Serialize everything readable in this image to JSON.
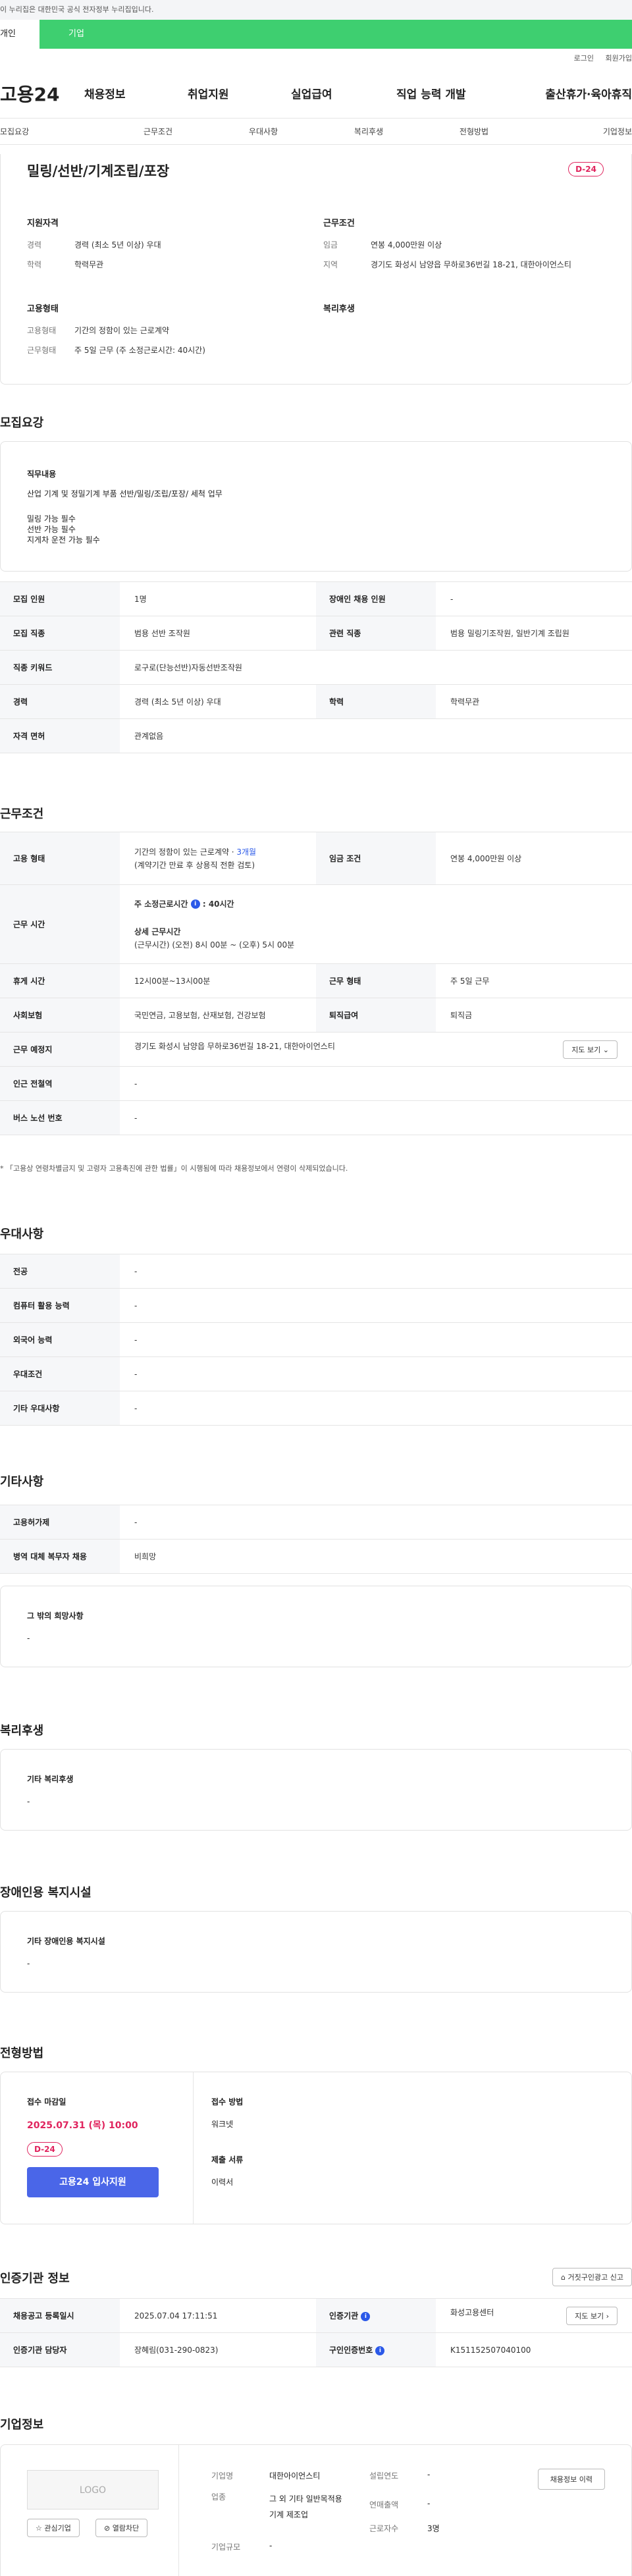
{
  "gov_banner": "이 누리집은 대한민국 공식 전자정부 누리집입니다.",
  "user_tabs": [
    "개인",
    "기업"
  ],
  "util_links": [
    "로그인",
    "회원가입"
  ],
  "site_logo": "고용24",
  "gnb": [
    "채용정보",
    "취업지원",
    "실업급여",
    "직업 능력 개발",
    "출산휴가·육아휴직"
  ],
  "lnb": [
    "모집요강",
    "근무조건",
    "우대사항",
    "복리후생",
    "전형방법",
    "기업정보"
  ],
  "job": {
    "title": "밀링/선반/기계조립/포장",
    "dday": "D-24",
    "qual_title": "지원자격",
    "career_k": "경력",
    "career_v": "경력 (최소 5년 이상) 우대",
    "edu_k": "학력",
    "edu_v": "학력무관",
    "emp_title": "고용형태",
    "emptype_k": "고용형태",
    "emptype_v": "기간의 정함이 있는 근로계약",
    "worktype_k": "근무형태",
    "worktype_v": "주 5일 근무 (주 소정근로시간: 40시간)",
    "cond_title": "근무조건",
    "wage_k": "임금",
    "wage_v": "연봉 4,000만원 이상",
    "region_k": "지역",
    "region_v": "경기도 화성시 남양읍 무하로36번길 18-21, 대한아이언스티",
    "welfare_title": "복리후생"
  },
  "recruit": {
    "title": "모집요강",
    "duty_label": "직무내용",
    "duty_line1": "산업 기계 및 정밀기계 부품 선반/밀링/조립/포장/ 세척 업무",
    "duty_line2": "밀링 가능 필수",
    "duty_line3": "선반 가능 필수",
    "duty_line4": "지게차 운전 가능 필수",
    "rows": {
      "r1h1": "모집 인원",
      "r1v1": "1명",
      "r1h2": "장애인 채용 인원",
      "r1v2": "-",
      "r2h1": "모집 직종",
      "r2v1": "범용 선반 조작원",
      "r2h2": "관련 직종",
      "r2v2": "범용 밀링기조작원, 일반기계 조립원",
      "r3h1": "직종 키워드",
      "r3v1": "로구로(단능선반)자동선반조작원",
      "r4h1": "경력",
      "r4v1": "경력 (최소 5년 이상) 우대",
      "r4h2": "학력",
      "r4v2": "학력무관",
      "r5h1": "자격 면허",
      "r5v1": "관계없음"
    }
  },
  "work": {
    "title": "근무조건",
    "emp_h": "고용 형태",
    "emp_v1": "기간의 정함이 있는 근로계약 · ",
    "emp_period": "3개월",
    "emp_v2": "(계약기간 만료 후 상용직 전환 검토)",
    "wage_h": "임금 조건",
    "wage_v": "연봉 4,000만원 이상",
    "hours_h": "근무 시간",
    "hours_l1": "주 소정근로시간",
    "hours_v1": "40시간",
    "hours_l2": "상세 근무시간",
    "hours_v2": "(근무시간) (오전) 8시 00분 ~ (오후) 5시 00분",
    "break_h": "휴게 시간",
    "break_v": "12시00분~13시00분",
    "form_h": "근무 형태",
    "form_v": "주 5일 근무",
    "ins_h": "사회보험",
    "ins_v": "국민연금, 고용보험, 산재보험, 건강보험",
    "sev_h": "퇴직급여",
    "sev_v": "퇴직금",
    "place_h": "근무 예정지",
    "place_v": "경기도 화성시 남양읍 무하로36번길 18-21, 대한아이언스티",
    "map_btn": "지도 보기",
    "station_h": "인근 전철역",
    "station_v": "-",
    "bus_h": "버스 노선 번호",
    "bus_v": "-",
    "note": "* 「고용상 연령차별금지 및 고령자 고용촉진에 관한 법률」이 시행됨에 따라 채용정보에서 연령이 삭제되었습니다."
  },
  "pref": {
    "title": "우대사항",
    "rows": [
      [
        "전공",
        "-"
      ],
      [
        "컴퓨터 활용 능력",
        "-"
      ],
      [
        "외국어 능력",
        "-"
      ],
      [
        "우대조건",
        "-"
      ],
      [
        "기타 우대사항",
        "-"
      ]
    ]
  },
  "etc": {
    "title": "기타사항",
    "r1h": "고용허가제",
    "r1v": "-",
    "r2h": "병역 대체 복무자 채용",
    "r2v": "비희망",
    "box_label": "그 밖의 희망사항",
    "box_value": "-"
  },
  "welfare": {
    "title": "복리후생",
    "box_label": "기타 복리후생",
    "box_value": "-"
  },
  "disab": {
    "title": "장애인용 복지시설",
    "box_label": "기타 장애인용 복지시설",
    "box_value": "-"
  },
  "sel": {
    "title": "전형방법",
    "deadline_label": "접수 마감일",
    "deadline_value": "2025.07.31 (목) 10:00",
    "dday": "D-24",
    "apply_btn": "고용24 입사지원",
    "method_label": "접수 방법",
    "method_value": "워크넷",
    "docs_label": "제출 서류",
    "docs_value": "이력서"
  },
  "cert": {
    "title": "인증기관 정보",
    "report_btn": "거짓구인광고 신고",
    "h1": "채용공고 등록일시",
    "v1": "2025.07.04 17:11:51",
    "h2": "인증기관",
    "v2": "화성고용센터",
    "map_btn": "지도 보기",
    "h3": "인증기관 담당자",
    "v3": "장혜림(031-290-0823)",
    "h4": "구인인증번호",
    "v4": "K151152507040100"
  },
  "company": {
    "title": "기업정보",
    "logo_placeholder": "LOGO",
    "fav_btn": "관심기업",
    "block_btn": "열람차단",
    "name_k": "기업명",
    "name_v": "대한아이언스티",
    "biz_k": "업종",
    "biz_v": "그 외 기타 일반목적용 기계 제조업",
    "size_k": "기업규모",
    "size_v": "-",
    "year_k": "설립연도",
    "year_v": "-",
    "sales_k": "연매출액",
    "sales_v": "-",
    "emp_k": "근로자수",
    "emp_v": "3명",
    "list_btn": "채용정보 이력"
  },
  "colors": {
    "accent": "#3ecf70",
    "dday": "#e0245e",
    "primary": "#4a66e8",
    "link": "#2b59e8"
  }
}
